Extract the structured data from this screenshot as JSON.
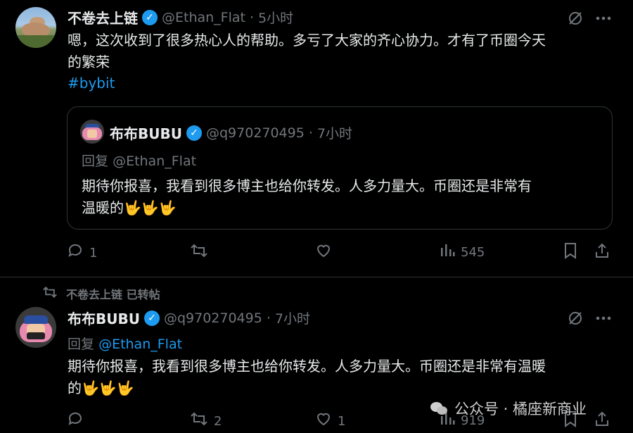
{
  "tweet1": {
    "name": "不卷去上链",
    "handle": "@Ethan_Flat",
    "sep": "·",
    "time": "5小时",
    "text_line1": "嗯，这次收到了很多热心人的帮助。多亏了大家的齐心协力。才有了币圈今天",
    "text_line2": "的繁荣",
    "hashtag": "#bybit",
    "quote": {
      "name": "布布BUBU",
      "handle": "@q970270495",
      "sep": "·",
      "time": "7小时",
      "reply_prefix": "回复",
      "reply_handle": "@Ethan_Flat",
      "text_line1": "期待你报喜，我看到很多博主也给你转发。人多力量大。币圈还是非常有",
      "text_line2": "温暖的🤟🤟🤟"
    },
    "actions": {
      "replies": "1",
      "reposts": "",
      "likes": "",
      "views": "545"
    }
  },
  "retweet_banner": {
    "text": "不卷去上链 已转帖"
  },
  "tweet2": {
    "name": "布布BUBU",
    "handle": "@q970270495",
    "sep": "·",
    "time": "7小时",
    "reply_prefix": "回复",
    "reply_handle": "@Ethan_Flat",
    "text_line1": "期待你报喜，我看到很多博主也给你转发。人多力量大。币圈还是非常有温暖",
    "text_line2": "的🤟🤟🤟",
    "actions": {
      "replies": "",
      "reposts": "2",
      "likes": "1",
      "views": "919"
    }
  },
  "watermark": {
    "text": "公众号 · 橘座新商业"
  },
  "icons": {
    "verified": "verified-badge",
    "grok": "grok-icon",
    "more": "more-icon",
    "reply": "reply-icon",
    "repost": "repost-icon",
    "like": "like-icon",
    "views": "views-icon",
    "bookmark": "bookmark-icon",
    "share": "share-icon"
  },
  "colors": {
    "accent": "#1d9bf0",
    "muted": "#71767b",
    "text": "#e7e9ea",
    "background": "#000000"
  }
}
